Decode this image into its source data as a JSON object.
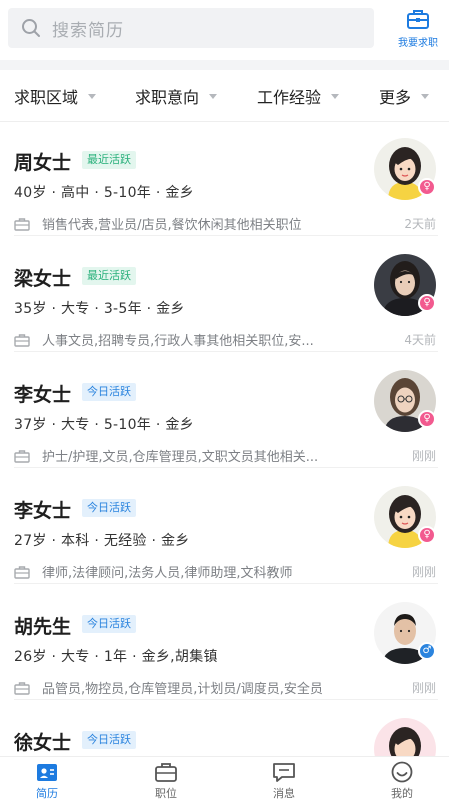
{
  "search": {
    "placeholder": "搜索简历"
  },
  "header_action": {
    "label": "我要求职"
  },
  "filters": [
    "求职区域",
    "求职意向",
    "工作经验",
    "更多"
  ],
  "candidates": [
    {
      "name": "周女士",
      "badge": "最近活跃",
      "badge_color": "#29b07b",
      "info": "40岁 · 高中 · 5-10年 · 金乡",
      "jobs": "销售代表,营业员/店员,餐饮休闲其他相关职位",
      "time": "2天前",
      "gender": "female",
      "avatar": "cartoon-woman-avatar"
    },
    {
      "name": "梁女士",
      "badge": "最近活跃",
      "badge_color": "#29b07b",
      "info": "35岁 · 大专 · 3-5年 · 金乡",
      "jobs": "人事文员,招聘专员,行政人事其他相关职位,安...",
      "time": "4天前",
      "gender": "female",
      "avatar": "photo-woman-avatar"
    },
    {
      "name": "李女士",
      "badge": "今日活跃",
      "badge_color": "#2b84de",
      "info": "37岁 · 大专 · 5-10年 · 金乡",
      "jobs": "护士/护理,文员,仓库管理员,文职文员其他相关...",
      "time": "刚刚",
      "gender": "female",
      "avatar": "photo-woman-glasses-avatar"
    },
    {
      "name": "李女士",
      "badge": "今日活跃",
      "badge_color": "#2b84de",
      "info": "27岁 · 本科 · 无经验 · 金乡",
      "jobs": "律师,法律顾问,法务人员,律师助理,文科教师",
      "time": "刚刚",
      "gender": "female",
      "avatar": "cartoon-woman-avatar"
    },
    {
      "name": "胡先生",
      "badge": "今日活跃",
      "badge_color": "#2b84de",
      "info": "26岁 · 大专 · 1年 · 金乡,胡集镇",
      "jobs": "品管员,物控员,仓库管理员,计划员/调度员,安全员",
      "time": "刚刚",
      "gender": "male",
      "avatar": "photo-man-avatar"
    },
    {
      "name": "徐女士",
      "badge": "今日活跃",
      "badge_color": "#2b84de",
      "info": "",
      "jobs": "",
      "time": "",
      "gender": "female",
      "avatar": "cartoon-woman-avatar"
    }
  ],
  "tabs": [
    {
      "label": "简历",
      "icon": "resume-icon",
      "active": true
    },
    {
      "label": "职位",
      "icon": "briefcase-icon",
      "active": false
    },
    {
      "label": "消息",
      "icon": "message-icon",
      "active": false
    },
    {
      "label": "我的",
      "icon": "profile-icon",
      "active": false
    }
  ]
}
